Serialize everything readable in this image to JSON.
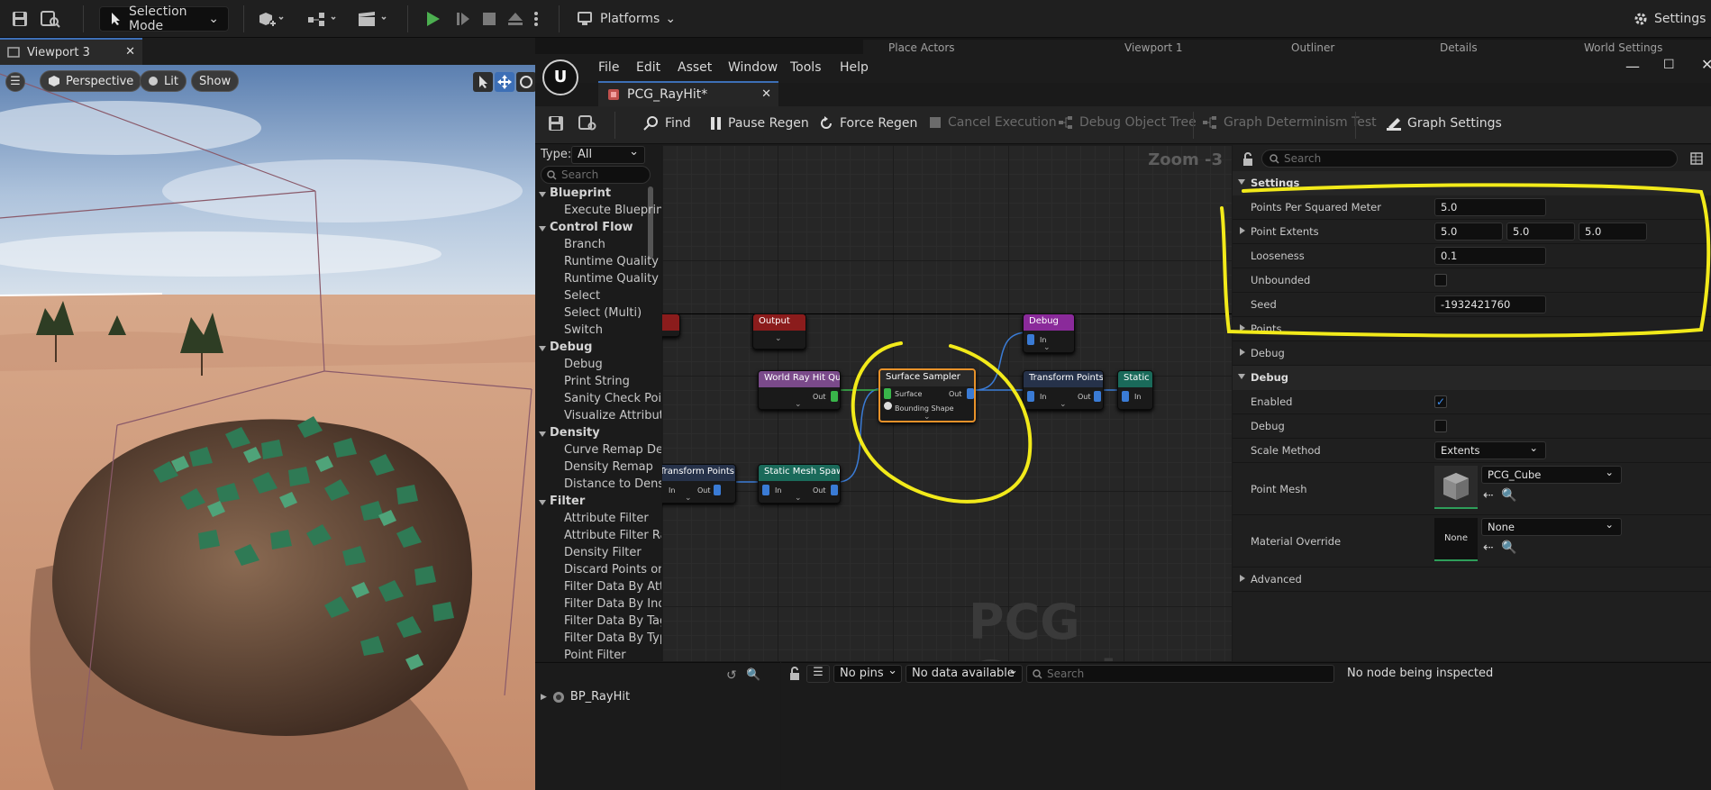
{
  "toolbar": {
    "mode": "Selection Mode",
    "platforms": "Platforms",
    "settings": "Settings"
  },
  "viewport": {
    "tab_title": "Viewport 3",
    "perspective": "Perspective",
    "lit": "Lit",
    "show": "Show"
  },
  "background_tabs": [
    "Place Actors",
    "Viewport 1",
    "Outliner",
    "Details",
    "World Settings"
  ],
  "pcg": {
    "menu": [
      "File",
      "Edit",
      "Asset",
      "Window",
      "Tools",
      "Help"
    ],
    "doc_tab": "PCG_RayHit*",
    "toolbar": {
      "find": "Find",
      "pause_regen": "Pause Regen",
      "force_regen": "Force Regen",
      "cancel_execution": "Cancel Execution",
      "debug_object_tree": "Debug Object Tree",
      "graph_determinism_test": "Graph Determinism Test",
      "graph_settings": "Graph Settings"
    },
    "palette": {
      "type_label": "Type:",
      "type_value": "All",
      "search_placeholder": "Search",
      "categories": [
        {
          "name": "Blueprint",
          "items": [
            "Execute Blueprint"
          ]
        },
        {
          "name": "Control Flow",
          "items": [
            "Branch",
            "Runtime Quality",
            "Runtime Quality",
            "Select",
            "Select (Multi)",
            "Switch"
          ]
        },
        {
          "name": "Debug",
          "items": [
            "Debug",
            "Print String",
            "Sanity Check Point",
            "Visualize Attribute"
          ]
        },
        {
          "name": "Density",
          "items": [
            "Curve Remap Density",
            "Density Remap",
            "Distance to Density"
          ]
        },
        {
          "name": "Filter",
          "items": [
            "Attribute Filter",
            "Attribute Filter Range",
            "Density Filter",
            "Discard Points on Bounds",
            "Filter Data By Attribute",
            "Filter Data By Index",
            "Filter Data By Tag",
            "Filter Data By Type",
            "Point Filter"
          ]
        }
      ]
    },
    "graph": {
      "zoom": "Zoom -3",
      "watermark": "PCG Graph",
      "nodes": {
        "output": {
          "title": "Output"
        },
        "debug": {
          "title": "Debug",
          "pin_in": "In"
        },
        "world_ray_hit_query": {
          "title": "World Ray Hit Query",
          "pin_out": "Out"
        },
        "surface_sampler": {
          "title": "Surface Sampler",
          "pin_surface": "Surface",
          "pin_bounding": "Bounding Shape",
          "pin_out": "Out"
        },
        "transform_points_right": {
          "title": "Transform Points",
          "pin_in": "In",
          "pin_out": "Out"
        },
        "static_partial": {
          "title": "Static",
          "pin_in": "In"
        },
        "transform_points_left": {
          "title": "Transform Points",
          "pin_in": "In",
          "pin_out": "Out"
        },
        "static_mesh_spawner": {
          "title": "Static Mesh Spawner",
          "pin_in": "In",
          "pin_out": "Out"
        }
      }
    },
    "details": {
      "search_placeholder": "Search",
      "settings_section": "Settings",
      "points_per_sq_meter_label": "Points Per Squared Meter",
      "points_per_sq_meter": "5.0",
      "point_extents_label": "Point Extents",
      "point_extents": [
        "5.0",
        "5.0",
        "5.0"
      ],
      "looseness_label": "Looseness",
      "looseness": "0.1",
      "unbounded_label": "Unbounded",
      "unbounded": false,
      "seed_label": "Seed",
      "seed": "-1932421760",
      "points_group": "Points",
      "debug_group": "Debug",
      "debug_section": "Debug",
      "enabled_label": "Enabled",
      "enabled": true,
      "debug_label": "Debug",
      "debug": false,
      "scale_method_label": "Scale Method",
      "scale_method": "Extents",
      "point_mesh_label": "Point Mesh",
      "point_mesh": "PCG_Cube",
      "material_override_label": "Material Override",
      "material_override": "None",
      "material_thumb": "None",
      "advanced_group": "Advanced"
    },
    "bottom": {
      "tree_item": "BP_RayHit",
      "pins_filter": "No pins",
      "data_filter": "No data available",
      "search_placeholder": "Search",
      "status": "No node being inspected"
    }
  },
  "colors": {
    "annotation_yellow": "#f2ea1a",
    "accent_blue": "#3d6fb6",
    "selection_orange": "#e8922a",
    "pin_blue": "#3a7bd5",
    "pin_green": "#39b54a"
  }
}
